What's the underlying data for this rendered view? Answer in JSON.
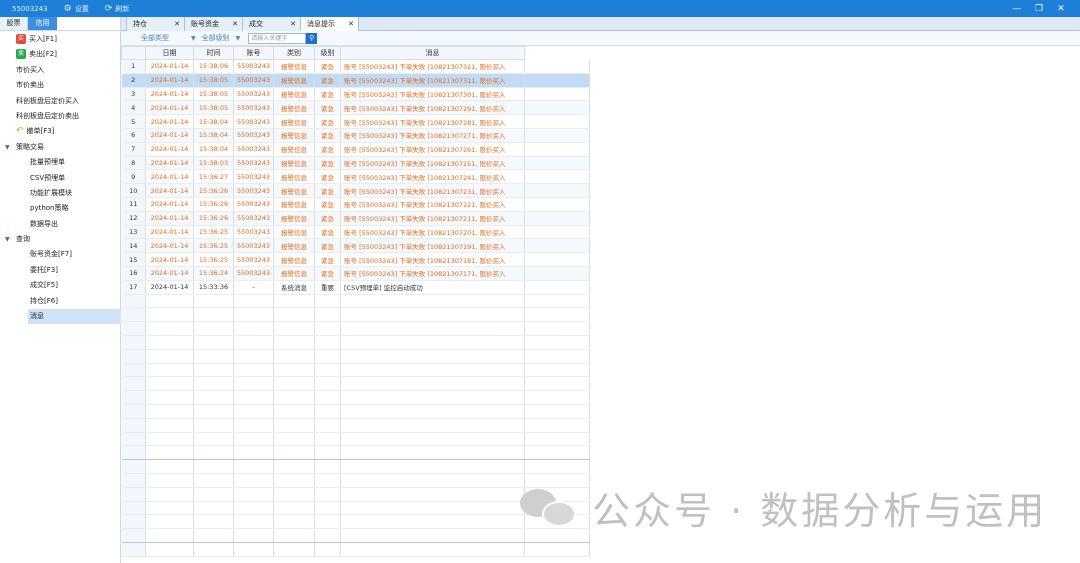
{
  "titlebar": {
    "account": "55003243",
    "settings_label": "设置",
    "refresh_label": "刷新",
    "settings_icon": "gear-icon",
    "refresh_icon": "refresh-icon"
  },
  "left_tabs": [
    "股票",
    "信用"
  ],
  "tree": {
    "buy": "买入[F1]",
    "sell": "卖出[F2]",
    "market_buy": "市价买入",
    "market_sell": "市价卖出",
    "star_after_buy": "科创板盘后定价买入",
    "star_after_sell": "科创板盘后定价卖出",
    "cancel": "撤单[F3]",
    "strategy_group": "策略交易",
    "batch_order": "批量预埋单",
    "csv_order": "CSV预埋单",
    "extension": "功能扩展模块",
    "python": "python策略",
    "export": "数据导出",
    "query_group": "查询",
    "funds": "账号资金[F7]",
    "entrust": "委托[F3]",
    "deal": "成交[F5]",
    "position": "持仓[F6]",
    "message": "消息"
  },
  "tabs": [
    "持仓",
    "账号资金",
    "成交",
    "消息提示"
  ],
  "filters": {
    "type": "全部类型",
    "level": "全部级别",
    "search_placeholder": "请输入关键字"
  },
  "table": {
    "headers": [
      "",
      "日期",
      "时间",
      "账号",
      "类别",
      "级别",
      "消息"
    ],
    "rows": [
      [
        "1",
        "2024-01-14",
        "15:38:06",
        "55003243",
        "报警信息",
        "紧急",
        "账号 [55003243] 下单失败 [10821307321, 限价买入"
      ],
      [
        "2",
        "2024-01-14",
        "15:38:05",
        "55003243",
        "报警信息",
        "紧急",
        "账号 [55003243] 下单失败 [10821307311, 限价买入"
      ],
      [
        "3",
        "2024-01-14",
        "15:38:05",
        "55003243",
        "报警信息",
        "紧急",
        "账号 [55003243] 下单失败 [10821307301, 限价买入"
      ],
      [
        "4",
        "2024-01-14",
        "15:38:05",
        "55003243",
        "报警信息",
        "紧急",
        "账号 [55003243] 下单失败 [10821307291, 限价买入"
      ],
      [
        "5",
        "2024-01-14",
        "15:38:04",
        "55003243",
        "报警信息",
        "紧急",
        "账号 [55003243] 下单失败 [10821307281, 限价买入"
      ],
      [
        "6",
        "2024-01-14",
        "15:38:04",
        "55003243",
        "报警信息",
        "紧急",
        "账号 [55003243] 下单失败 [10821307271, 限价买入"
      ],
      [
        "7",
        "2024-01-14",
        "15:38:04",
        "55003243",
        "报警信息",
        "紧急",
        "账号 [55003243] 下单失败 [10821307261, 限价买入"
      ],
      [
        "8",
        "2024-01-14",
        "15:38:03",
        "55003243",
        "报警信息",
        "紧急",
        "账号 [55003243] 下单失败 [10821307251, 限价买入"
      ],
      [
        "9",
        "2024-01-14",
        "15:36:27",
        "55003243",
        "报警信息",
        "紧急",
        "账号 [55003243] 下单失败 [10821307241, 限价买入"
      ],
      [
        "10",
        "2024-01-14",
        "15:36:26",
        "55003243",
        "报警信息",
        "紧急",
        "账号 [55003243] 下单失败 [10821307231, 限价买入"
      ],
      [
        "11",
        "2024-01-14",
        "15:36:26",
        "55003243",
        "报警信息",
        "紧急",
        "账号 [55003243] 下单失败 [10821307221, 限价买入"
      ],
      [
        "12",
        "2024-01-14",
        "15:36:26",
        "55003243",
        "报警信息",
        "紧急",
        "账号 [55003243] 下单失败 [10821307211, 限价买入"
      ],
      [
        "13",
        "2024-01-14",
        "15:36:25",
        "55003243",
        "报警信息",
        "紧急",
        "账号 [55003243] 下单失败 [10821307201, 限价买入"
      ],
      [
        "14",
        "2024-01-14",
        "15:36:25",
        "55003243",
        "报警信息",
        "紧急",
        "账号 [55003243] 下单失败 [10821307191, 限价买入"
      ],
      [
        "15",
        "2024-01-14",
        "15:36:25",
        "55003243",
        "报警信息",
        "紧急",
        "账号 [55003243] 下单失败 [10821307181, 限价买入"
      ],
      [
        "16",
        "2024-01-14",
        "15:36:24",
        "55003243",
        "报警信息",
        "紧急",
        "账号 [55003243] 下单失败 [10821307171, 限价买入"
      ],
      [
        "17",
        "2024-01-14",
        "15:33:36",
        "-",
        "系统消息",
        "重要",
        "[CSV预埋单] 监控启动成功"
      ]
    ],
    "selected_row": 2
  },
  "watermark": "公众号 · 数据分析与运用",
  "colors": {
    "titlebar": "#1e7fd9",
    "warning_text": "#e86a1a",
    "selected_row": "#c2dbf5"
  }
}
